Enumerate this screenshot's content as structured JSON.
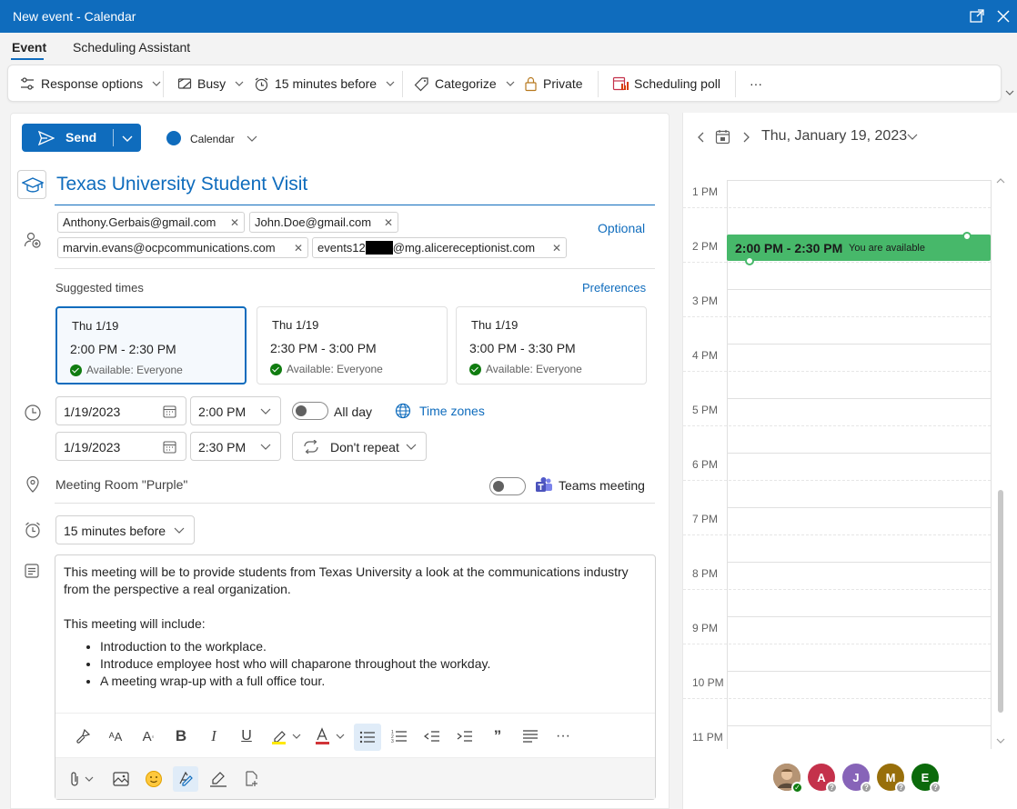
{
  "window": {
    "title": "New event - Calendar"
  },
  "tabs": [
    {
      "label": "Event"
    },
    {
      "label": "Scheduling Assistant"
    }
  ],
  "ribbon": {
    "response_options": "Response options",
    "busy": "Busy",
    "reminder": "15 minutes before",
    "categorize": "Categorize",
    "private": "Private",
    "scheduling_poll": "Scheduling poll",
    "more": "···"
  },
  "compose": {
    "send_label": "Send",
    "calendar_label": "Calendar",
    "subject": "Texas University Student Visit",
    "attendees": [
      {
        "email": "Anthony.Gerbais@gmail.com"
      },
      {
        "email": "John.Doe@gmail.com"
      },
      {
        "email": "marvin.evans@ocpcommunications.com"
      },
      {
        "email_prefix": "events12",
        "email_suffix": "@mg.alicereceptionist.com"
      }
    ],
    "optional_label": "Optional",
    "suggested_times_label": "Suggested times",
    "preferences_label": "Preferences",
    "suggestions": [
      {
        "date": "Thu 1/19",
        "time": "2:00 PM - 2:30 PM",
        "availability": "Available: Everyone",
        "selected": true
      },
      {
        "date": "Thu 1/19",
        "time": "2:30 PM - 3:00 PM",
        "availability": "Available: Everyone",
        "selected": false
      },
      {
        "date": "Thu 1/19",
        "time": "3:00 PM - 3:30 PM",
        "availability": "Available: Everyone",
        "selected": false
      }
    ],
    "start_date": "1/19/2023",
    "start_time": "2:00 PM",
    "end_date": "1/19/2023",
    "end_time": "2:30 PM",
    "all_day_label": "All day",
    "time_zones_label": "Time zones",
    "repeat_label": "Don't repeat",
    "location": "Meeting Room \"Purple\"",
    "teams_label": "Teams meeting",
    "reminder": "15 minutes before",
    "body": {
      "intro": "This meeting will be to provide students from Texas University a look at the communications industry from the perspective a real organization.",
      "include": "This meeting will include:",
      "bullets": [
        "Introduction to the workplace.",
        "Introduce employee host who will chaparone throughout the workday.",
        "A meeting wrap-up with a full office tour."
      ]
    },
    "format_more": "···"
  },
  "side_calendar": {
    "date_label": "Thu, January 19, 2023",
    "hours": [
      "1 PM",
      "2 PM",
      "3 PM",
      "4 PM",
      "5 PM",
      "6 PM",
      "7 PM",
      "8 PM",
      "9 PM",
      "10 PM",
      "11 PM"
    ],
    "event_time": "2:00 PM - 2:30 PM",
    "event_status": "You are available",
    "attendee_avatars": [
      {
        "initial": "",
        "color": "#8a6a4a",
        "status": "available"
      },
      {
        "initial": "A",
        "color": "#c4314b",
        "status": "unknown"
      },
      {
        "initial": "J",
        "color": "#8764b8",
        "status": "unknown"
      },
      {
        "initial": "M",
        "color": "#986f0b",
        "status": "unknown"
      },
      {
        "initial": "E",
        "color": "#0b6a0b",
        "status": "unknown"
      }
    ]
  },
  "colors": {
    "accent": "#0f6cbd",
    "event_green": "#47b86a",
    "available_green": "#107c10"
  }
}
